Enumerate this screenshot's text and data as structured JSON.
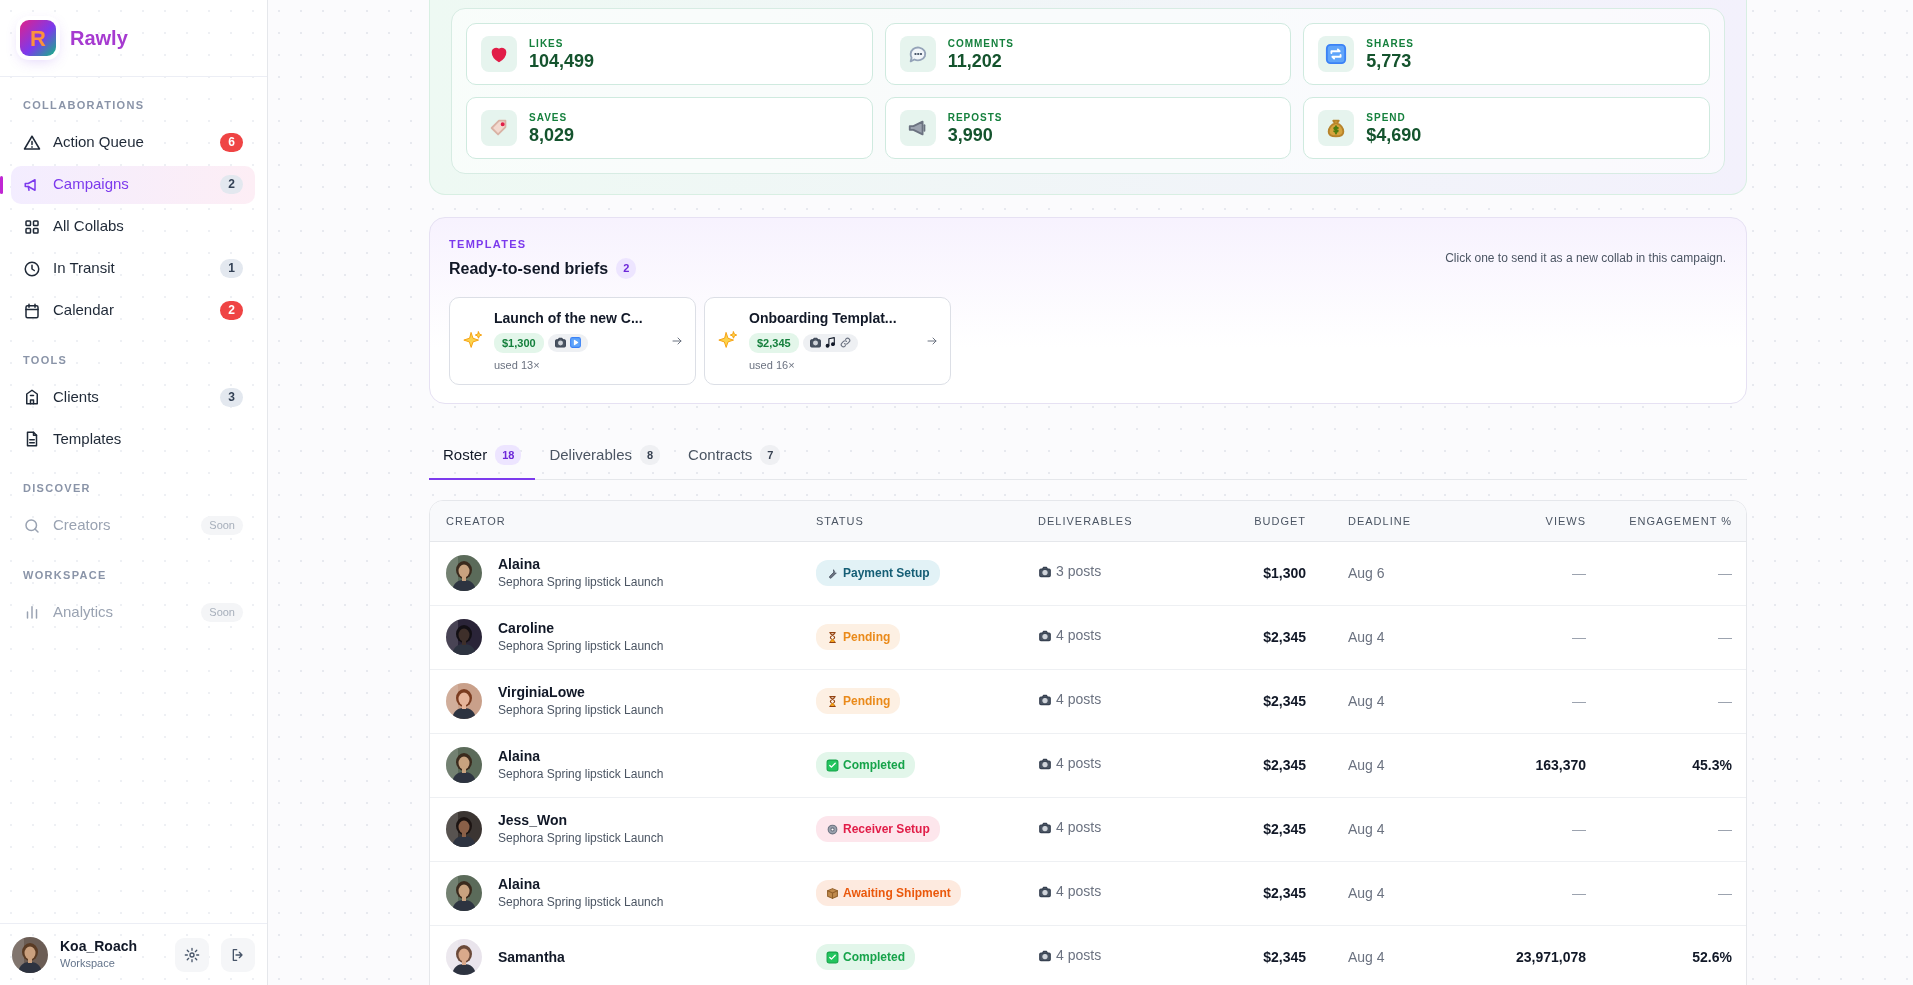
{
  "brand": {
    "logo_letter": "R",
    "name": "Rawly"
  },
  "nav_sections": [
    {
      "title": "COLLABORATIONS",
      "items": [
        {
          "label": "Action Queue",
          "badge": "6",
          "kind": "alert",
          "selected": false,
          "disabled": false
        },
        {
          "label": "Campaigns",
          "badge": "2",
          "kind": "neutral",
          "selected": true,
          "disabled": false
        },
        {
          "label": "All Collabs",
          "selected": false,
          "disabled": false
        },
        {
          "label": "In Transit",
          "badge": "1",
          "kind": "neutral",
          "selected": false,
          "disabled": false
        },
        {
          "label": "Calendar",
          "badge": "2",
          "kind": "alert",
          "selected": false,
          "disabled": false
        }
      ]
    },
    {
      "title": "TOOLS",
      "items": [
        {
          "label": "Clients",
          "badge": "3",
          "kind": "neutral",
          "selected": false,
          "disabled": false
        },
        {
          "label": "Templates",
          "selected": false,
          "disabled": false
        }
      ]
    },
    {
      "title": "DISCOVER",
      "items": [
        {
          "label": "Creators",
          "badge": "Soon",
          "kind": "soon",
          "selected": false,
          "disabled": true
        }
      ]
    },
    {
      "title": "WORKSPACE",
      "items": [
        {
          "label": "Analytics",
          "badge": "Soon",
          "kind": "soon",
          "selected": false,
          "disabled": true
        }
      ]
    }
  ],
  "user": {
    "name": "Koa_Roach",
    "subtitle": "Workspace"
  },
  "stats": [
    {
      "label": "LIKES",
      "value": "104,499"
    },
    {
      "label": "COMMENTS",
      "value": "11,202"
    },
    {
      "label": "SHARES",
      "value": "5,773"
    },
    {
      "label": "SAVES",
      "value": "8,029"
    },
    {
      "label": "REPOSTS",
      "value": "3,990"
    },
    {
      "label": "SPEND",
      "value": "$4,690"
    }
  ],
  "templates": {
    "eyebrow": "TEMPLATES",
    "title": "Ready-to-send briefs",
    "count": "2",
    "hint": "Click one to send it as a new collab in this campaign.",
    "items": [
      {
        "title": "Launch of the new C...",
        "price": "$1,300",
        "usage": "used 13×"
      },
      {
        "title": "Onboarding Templat...",
        "price": "$2,345",
        "usage": "used 16×"
      }
    ]
  },
  "tabs": [
    {
      "label": "Roster",
      "count": "18",
      "selected": true
    },
    {
      "label": "Deliverables",
      "count": "8",
      "selected": false
    },
    {
      "label": "Contracts",
      "count": "7",
      "selected": false
    }
  ],
  "table": {
    "columns": [
      "CREATOR",
      "STATUS",
      "DELIVERABLES",
      "BUDGET",
      "DEADLINE",
      "VIEWS",
      "ENGAGEMENT %"
    ],
    "rows": [
      {
        "name": "Alaina",
        "campaign": "Sephora Spring lipstick Launch",
        "status": "Payment Setup",
        "kind": "setup",
        "deliverables": "3 posts",
        "budget": "$1,300",
        "deadline": "Aug 6",
        "views": "—",
        "engagement": "—"
      },
      {
        "name": "Caroline",
        "campaign": "Sephora Spring lipstick Launch",
        "status": "Pending",
        "kind": "pending",
        "deliverables": "4 posts",
        "budget": "$2,345",
        "deadline": "Aug 4",
        "views": "—",
        "engagement": "—"
      },
      {
        "name": "VirginiaLowe",
        "campaign": "Sephora Spring lipstick Launch",
        "status": "Pending",
        "kind": "pending",
        "deliverables": "4 posts",
        "budget": "$2,345",
        "deadline": "Aug 4",
        "views": "—",
        "engagement": "—"
      },
      {
        "name": "Alaina",
        "campaign": "Sephora Spring lipstick Launch",
        "status": "Completed",
        "kind": "completed",
        "deliverables": "4 posts",
        "budget": "$2,345",
        "deadline": "Aug 4",
        "views": "163,370",
        "engagement": "45.3%"
      },
      {
        "name": "Jess_Won",
        "campaign": "Sephora Spring lipstick Launch",
        "status": "Receiver Setup",
        "kind": "receiver",
        "deliverables": "4 posts",
        "budget": "$2,345",
        "deadline": "Aug 4",
        "views": "—",
        "engagement": "—"
      },
      {
        "name": "Alaina",
        "campaign": "Sephora Spring lipstick Launch",
        "status": "Awaiting Shipment",
        "kind": "shipping",
        "deliverables": "4 posts",
        "budget": "$2,345",
        "deadline": "Aug 4",
        "views": "—",
        "engagement": "—"
      },
      {
        "name": "Samantha",
        "status": "Completed",
        "kind": "completed",
        "deliverables": "4 posts",
        "budget": "$2,345",
        "deadline": "Aug 4",
        "views": "23,971,078",
        "engagement": "52.6%"
      }
    ]
  }
}
